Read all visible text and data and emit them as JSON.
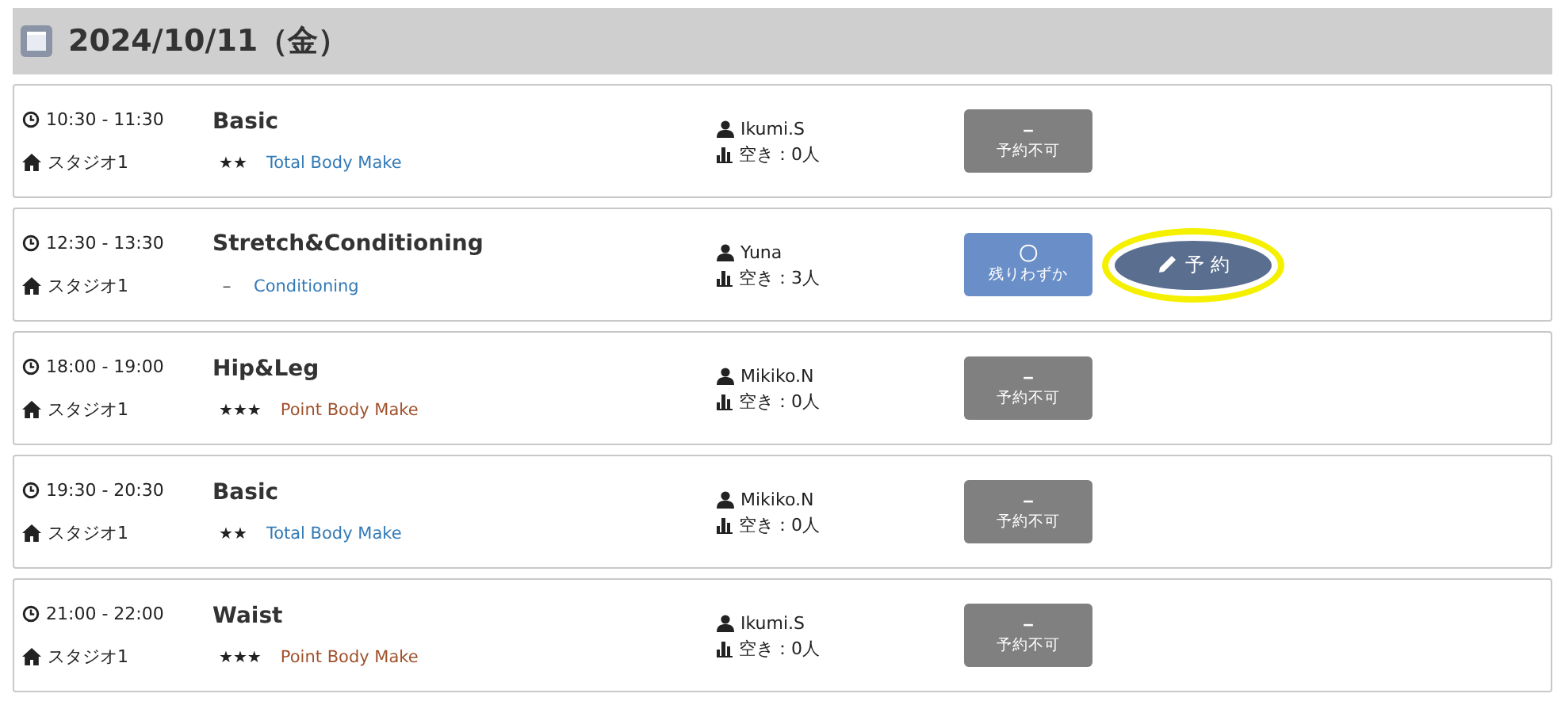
{
  "date_header": {
    "title": "2024/10/11（金）"
  },
  "lessons": [
    {
      "time": "10:30 - 11:30",
      "studio": "スタジオ1",
      "name": "Basic",
      "intensity": "★★",
      "category": "Total Body Make",
      "color": "#337ab7",
      "instructor": "Ikumi.S",
      "vacancy": "空き：0人",
      "status": {
        "kind": "unavailable",
        "mark": "－",
        "label": "予約不可"
      }
    },
    {
      "time": "12:30 - 13:30",
      "studio": "スタジオ1",
      "name": "Stretch&Conditioning",
      "intensity": "－",
      "category": "Conditioning",
      "color": "#337ab7",
      "instructor": "Yuna",
      "vacancy": "空き：3人",
      "status": {
        "kind": "few",
        "mark": "〇",
        "label": "残りわずか"
      },
      "reserve": {
        "label": "予 約",
        "highlighted": true
      }
    },
    {
      "time": "18:00 - 19:00",
      "studio": "スタジオ1",
      "name": "Hip&Leg",
      "intensity": "★★★",
      "category": "Point Body Make",
      "color": "#a0522d",
      "instructor": "Mikiko.N",
      "vacancy": "空き：0人",
      "status": {
        "kind": "unavailable",
        "mark": "－",
        "label": "予約不可"
      }
    },
    {
      "time": "19:30 - 20:30",
      "studio": "スタジオ1",
      "name": "Basic",
      "intensity": "★★",
      "category": "Total Body Make",
      "color": "#337ab7",
      "instructor": "Mikiko.N",
      "vacancy": "空き：0人",
      "status": {
        "kind": "unavailable",
        "mark": "－",
        "label": "予約不可"
      }
    },
    {
      "time": "21:00 - 22:00",
      "studio": "スタジオ1",
      "name": "Waist",
      "intensity": "★★★",
      "category": "Point Body Make",
      "color": "#a0522d",
      "instructor": "Ikumi.S",
      "vacancy": "空き：0人",
      "status": {
        "kind": "unavailable",
        "mark": "－",
        "label": "予約不可"
      }
    }
  ]
}
